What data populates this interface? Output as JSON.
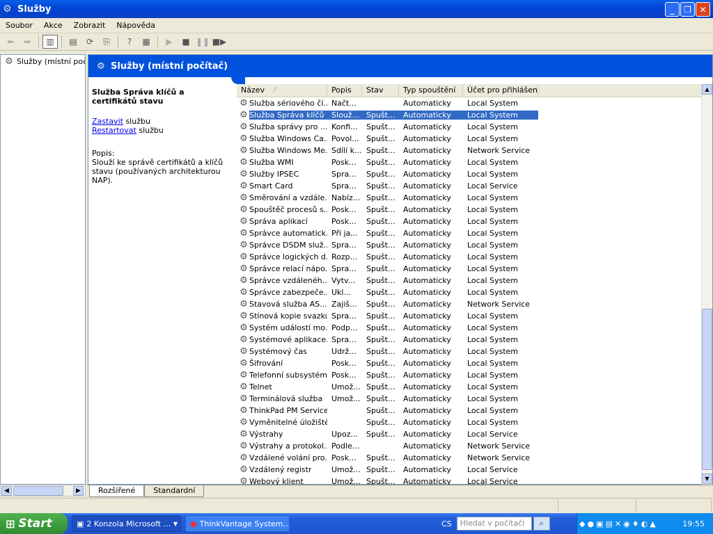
{
  "window": {
    "title": "Služby"
  },
  "menu": [
    "Soubor",
    "Akce",
    "Zobrazit",
    "Nápověda"
  ],
  "tree": {
    "root_label": "Služby (místní počítač)"
  },
  "header": {
    "title": "Služby (místní počítač)"
  },
  "description": {
    "title": "Služba Správa klíčů a certifikátů stavu",
    "stop_link": "Zastavit",
    "stop_suffix": " službu",
    "restart_link": "Restartovat",
    "restart_suffix": " službu",
    "label": "Popis:",
    "text": "Slouží ke správě certifikátů a klíčů stavu (používaných architekturou NAP)."
  },
  "columns": [
    "Název",
    "Popis",
    "Stav",
    "Typ spouštění",
    "Účet pro přihlášení"
  ],
  "services": [
    {
      "name": "Služba sériového čí...",
      "desc": "Načt...",
      "status": "",
      "startup": "Automaticky",
      "account": "Local System"
    },
    {
      "name": "Služba Správa klíčů ...",
      "desc": "Slouž...",
      "status": "Spušt...",
      "startup": "Automaticky",
      "account": "Local System",
      "selected": true
    },
    {
      "name": "Služba správy pro ...",
      "desc": "Konfi...",
      "status": "Spušt...",
      "startup": "Automaticky",
      "account": "Local System"
    },
    {
      "name": "Služba Windows Ca...",
      "desc": "Povol...",
      "status": "Spušt...",
      "startup": "Automaticky",
      "account": "Local System"
    },
    {
      "name": "Služba Windows Me...",
      "desc": "Sdílí k...",
      "status": "Spušt...",
      "startup": "Automaticky",
      "account": "Network Service"
    },
    {
      "name": "Služba WMI",
      "desc": "Posk...",
      "status": "Spušt...",
      "startup": "Automaticky",
      "account": "Local System"
    },
    {
      "name": "Služby IPSEC",
      "desc": "Spra...",
      "status": "Spušt...",
      "startup": "Automaticky",
      "account": "Local System"
    },
    {
      "name": "Smart Card",
      "desc": "Spra...",
      "status": "Spušt...",
      "startup": "Automaticky",
      "account": "Local Service"
    },
    {
      "name": "Směrování a vzdále...",
      "desc": "Nabíz...",
      "status": "Spušt...",
      "startup": "Automaticky",
      "account": "Local System"
    },
    {
      "name": "Spouštěč procesů s...",
      "desc": "Posk...",
      "status": "Spušt...",
      "startup": "Automaticky",
      "account": "Local System"
    },
    {
      "name": "Správa aplikací",
      "desc": "Posk...",
      "status": "Spušt...",
      "startup": "Automaticky",
      "account": "Local System"
    },
    {
      "name": "Správce automatick...",
      "desc": "Při ja...",
      "status": "Spušt...",
      "startup": "Automaticky",
      "account": "Local System"
    },
    {
      "name": "Správce DSDM služ...",
      "desc": "Spra...",
      "status": "Spušt...",
      "startup": "Automaticky",
      "account": "Local System"
    },
    {
      "name": "Správce logických d...",
      "desc": "Rozp...",
      "status": "Spušt...",
      "startup": "Automaticky",
      "account": "Local System"
    },
    {
      "name": "Správce relací nápo...",
      "desc": "Spra...",
      "status": "Spušt...",
      "startup": "Automaticky",
      "account": "Local System"
    },
    {
      "name": "Správce vzdálenéh...",
      "desc": "Vytv...",
      "status": "Spušt...",
      "startup": "Automaticky",
      "account": "Local System"
    },
    {
      "name": "Správce zabezpeče...",
      "desc": "Ukl...",
      "status": "Spušt...",
      "startup": "Automaticky",
      "account": "Local System"
    },
    {
      "name": "Stavová služba AS...",
      "desc": "Zajiš...",
      "status": "Spušt...",
      "startup": "Automaticky",
      "account": "Network Service"
    },
    {
      "name": "Stínová kopie svazku",
      "desc": "Spra...",
      "status": "Spušt...",
      "startup": "Automaticky",
      "account": "Local System"
    },
    {
      "name": "Systém událostí mo...",
      "desc": "Podp...",
      "status": "Spušt...",
      "startup": "Automaticky",
      "account": "Local System"
    },
    {
      "name": "Systémové aplikace...",
      "desc": "Spra...",
      "status": "Spušt...",
      "startup": "Automaticky",
      "account": "Local System"
    },
    {
      "name": "Systémový čas",
      "desc": "Udrž...",
      "status": "Spušt...",
      "startup": "Automaticky",
      "account": "Local System"
    },
    {
      "name": "Šifrování",
      "desc": "Posk...",
      "status": "Spušt...",
      "startup": "Automaticky",
      "account": "Local System"
    },
    {
      "name": "Telefonní subsystém",
      "desc": "Posk...",
      "status": "Spušt...",
      "startup": "Automaticky",
      "account": "Local System"
    },
    {
      "name": "Telnet",
      "desc": "Umož...",
      "status": "Spušt...",
      "startup": "Automaticky",
      "account": "Local System"
    },
    {
      "name": "Terminálová služba",
      "desc": "Umož...",
      "status": "Spušt...",
      "startup": "Automaticky",
      "account": "Local System"
    },
    {
      "name": "ThinkPad PM Service",
      "desc": "",
      "status": "Spušt...",
      "startup": "Automaticky",
      "account": "Local System"
    },
    {
      "name": "Vyměnitelné úložiště",
      "desc": "",
      "status": "Spušt...",
      "startup": "Automaticky",
      "account": "Local System"
    },
    {
      "name": "Výstrahy",
      "desc": "Upoz...",
      "status": "Spušt...",
      "startup": "Automaticky",
      "account": "Local Service"
    },
    {
      "name": "Výstrahy a protokol...",
      "desc": "Podle...",
      "status": "",
      "startup": "Automaticky",
      "account": "Network Service"
    },
    {
      "name": "Vzdálené volání pro...",
      "desc": "Posk...",
      "status": "Spušt...",
      "startup": "Automaticky",
      "account": "Network Service"
    },
    {
      "name": "Vzdálený registr",
      "desc": "Umož...",
      "status": "Spušt...",
      "startup": "Automaticky",
      "account": "Local Service"
    },
    {
      "name": "Webový klient",
      "desc": "Umož...",
      "status": "Spušt...",
      "startup": "Automaticky",
      "account": "Local Service"
    }
  ],
  "tabs": [
    "Rozšířené",
    "Standardní"
  ],
  "taskbar": {
    "start": "Start",
    "tasks": [
      "2 Konzola Microsoft ...",
      "ThinkVantage System..."
    ],
    "lang": "CS",
    "search_placeholder": "Hledat v počítači",
    "clock": "19:55"
  },
  "icons": [
    "services-gear-icon",
    "back-arrow-icon",
    "forward-arrow-icon",
    "play-icon",
    "stop-icon",
    "pause-icon",
    "restart-icon",
    "search-icon"
  ],
  "colors": {
    "accent": "#0052dd",
    "selection": "#316ac5",
    "taskbar": "#245edb",
    "start": "#3c9a3c"
  }
}
